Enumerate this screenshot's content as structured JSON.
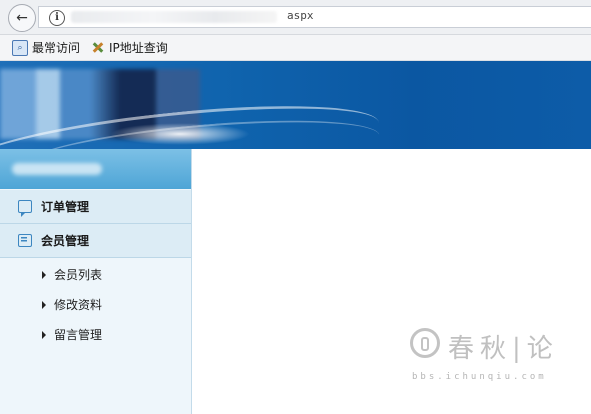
{
  "browser": {
    "url_visible_suffix": "aspx",
    "bookmarks": [
      {
        "label": "最常访问",
        "icon": "bookmark-search-icon"
      },
      {
        "label": "IP地址查询",
        "icon": "tools-icon"
      }
    ]
  },
  "sidebar": {
    "menus": [
      {
        "label": "订单管理",
        "icon": "chat-bubble-icon"
      },
      {
        "label": "会员管理",
        "icon": "list-icon"
      }
    ],
    "submenu": [
      {
        "label": "会员列表"
      },
      {
        "label": "修改资料"
      },
      {
        "label": "留言管理"
      }
    ]
  },
  "watermark": {
    "text": "春秋|论",
    "url": "bbs.ichunqiu.com"
  },
  "colors": {
    "banner": "#0f63ad",
    "sidebar_bg": "#eef6fb",
    "menu_bg": "#dcecf5"
  }
}
